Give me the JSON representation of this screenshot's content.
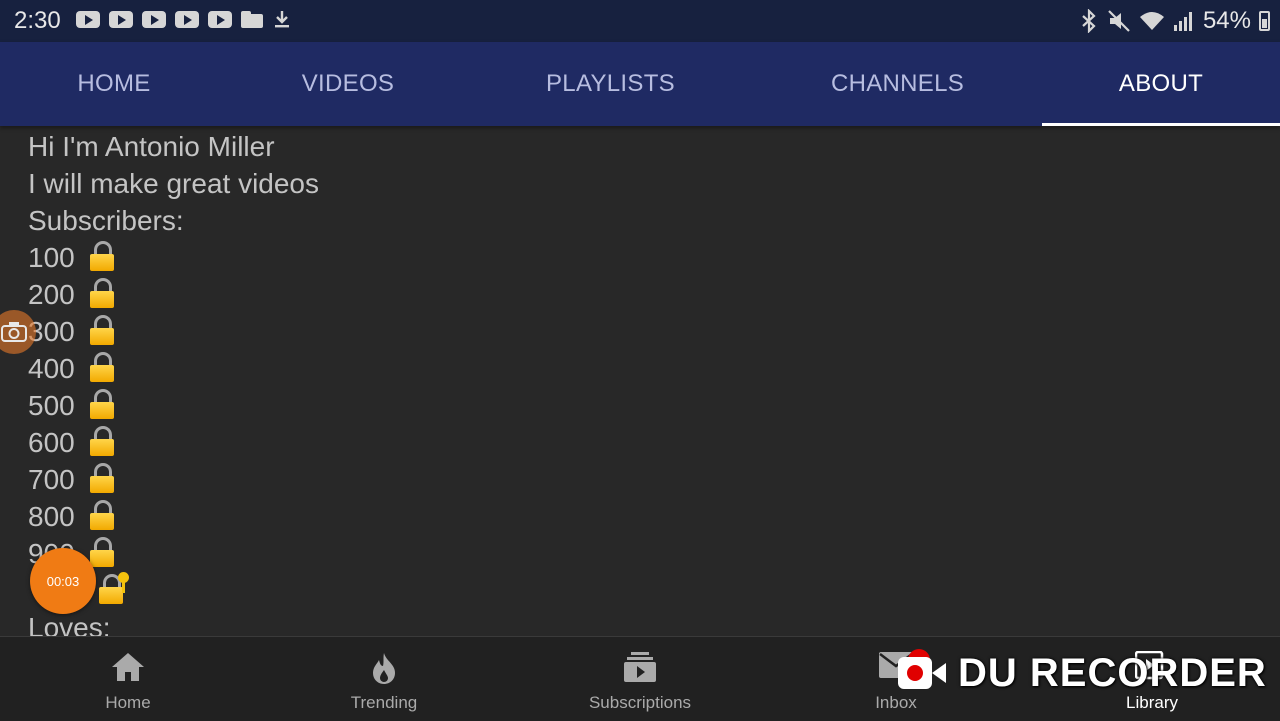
{
  "status_bar": {
    "time": "2:30",
    "notification_icons": [
      "youtube-icon",
      "youtube-icon",
      "youtube-icon",
      "youtube-icon",
      "youtube-icon",
      "folder-icon",
      "download-icon"
    ],
    "battery": "54%"
  },
  "tabs": [
    {
      "label": "HOME"
    },
    {
      "label": "VIDEOS"
    },
    {
      "label": "PLAYLISTS"
    },
    {
      "label": "CHANNELS"
    },
    {
      "label": "ABOUT",
      "active": true
    }
  ],
  "about": {
    "intro": "Hi I'm Antonio Miller",
    "tagline": "I will make great videos",
    "subscribers_heading": "Subscribers:",
    "milestones": [
      "100",
      "200",
      "300",
      "400",
      "500",
      "600",
      "700",
      "800",
      "900"
    ],
    "loves_heading": "Loves:"
  },
  "recorder": {
    "timer": "00:03",
    "watermark": "DU RECORDER"
  },
  "bottom_nav": [
    {
      "label": "Home",
      "icon": "home-icon"
    },
    {
      "label": "Trending",
      "icon": "flame-icon"
    },
    {
      "label": "Subscriptions",
      "icon": "subscriptions-icon"
    },
    {
      "label": "Inbox",
      "icon": "mail-icon"
    },
    {
      "label": "Library",
      "icon": "library-icon",
      "active": true
    }
  ],
  "colors": {
    "status_bar": "#17213f",
    "tab_bar": "#1f2a63",
    "background": "#282828",
    "bottom_nav": "#212121",
    "lock": "#f2a900",
    "recorder_bubble": "#f07b14"
  }
}
